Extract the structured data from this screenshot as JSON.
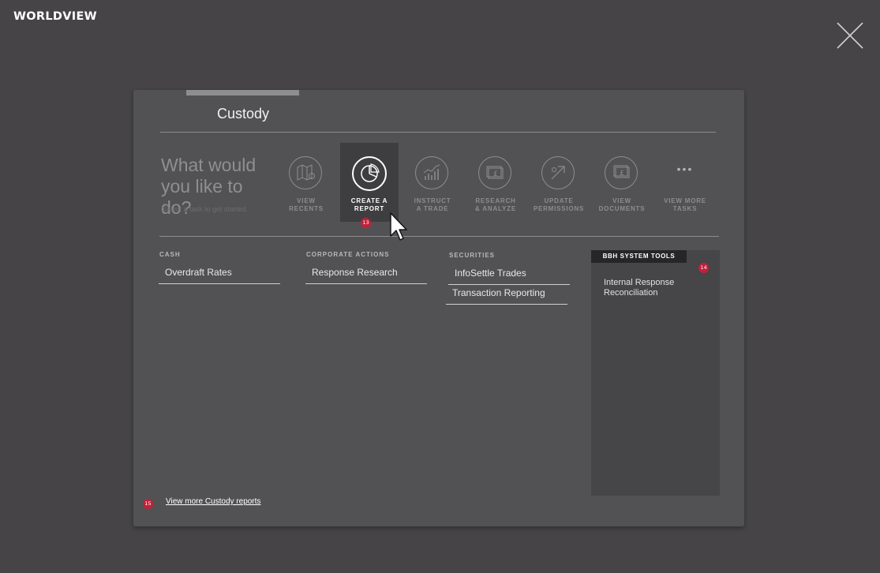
{
  "app": {
    "logo": "WORLDVIEW"
  },
  "panel": {
    "title": "Custody",
    "prompt": "What would you like to do?",
    "prompt_sub": "Select a task to get started.",
    "tasks": [
      {
        "label_line1": "VIEW",
        "label_line2": "RECENTS",
        "icon": "map-pin-icon"
      },
      {
        "label_line1": "CREATE A",
        "label_line2": "REPORT",
        "icon": "pie-chart-icon",
        "active": true,
        "badge": "13"
      },
      {
        "label_line1": "INSTRUCT",
        "label_line2": "A TRADE",
        "icon": "trade-chart-icon"
      },
      {
        "label_line1": "RESEARCH",
        "label_line2": "& ANALYZE",
        "icon": "pound-document-icon"
      },
      {
        "label_line1": "UPDATE",
        "label_line2": "PERMISSIONS",
        "icon": "arrow-up-right-icon"
      },
      {
        "label_line1": "VIEW",
        "label_line2": "DOCUMENTS",
        "icon": "documents-icon"
      },
      {
        "label_line1": "VIEW MORE",
        "label_line2": "TASKS",
        "icon": "more-dots-icon",
        "dots": "•••"
      }
    ],
    "columns": {
      "cash": {
        "header": "CASH",
        "items": [
          "Overdraft Rates"
        ]
      },
      "corporate_actions": {
        "header": "CORPORATE ACTIONS",
        "items": [
          "Response Research"
        ]
      },
      "securities": {
        "header": "SECURITIES",
        "items": [
          "InfoSettle Trades",
          "Transaction Reporting"
        ]
      }
    },
    "tools": {
      "header": "BBH SYSTEM TOOLS",
      "badge": "14",
      "items": [
        "Internal Response Reconciliation"
      ]
    },
    "more_link": "View more Custody reports",
    "more_badge": "15"
  },
  "colors": {
    "background": "#464447",
    "panel": "#525254",
    "badge": "#c2203a",
    "tools_header": "#262528"
  }
}
